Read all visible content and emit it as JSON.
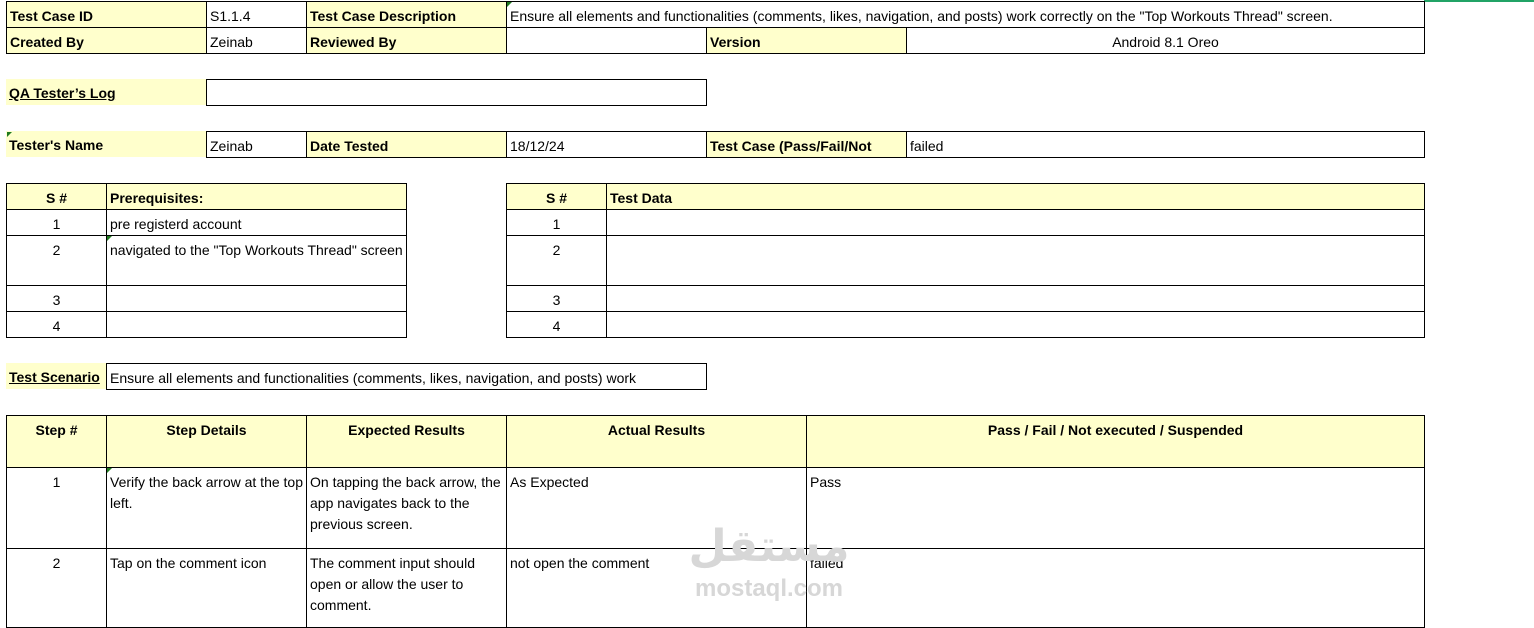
{
  "header": {
    "test_case_id_label": "Test Case ID",
    "test_case_id": "S1.1.4",
    "description_label": "Test Case Description",
    "description": "Ensure all elements and functionalities (comments, likes, navigation, and posts) work correctly on the \"Top Workouts Thread\" screen.",
    "created_by_label": "Created By",
    "created_by": "Zeinab",
    "reviewed_by_label": "Reviewed By",
    "reviewed_by": "",
    "version_label": "Version",
    "version": "Android 8.1 Oreo"
  },
  "qa_log": {
    "label": "QA Tester’s Log",
    "value": ""
  },
  "tester": {
    "name_label": "Tester's Name",
    "name": "Zeinab",
    "date_label": "Date Tested",
    "date": "18/12/24",
    "result_label": "Test Case (Pass/Fail/Not",
    "result": "failed"
  },
  "prerequisites": {
    "num_header": "S #",
    "header": "Prerequisites:",
    "rows": [
      {
        "num": "1",
        "text": "pre registerd account"
      },
      {
        "num": "2",
        "text": " navigated to the \"Top Workouts Thread\" screen"
      },
      {
        "num": "3",
        "text": ""
      },
      {
        "num": "4",
        "text": ""
      }
    ]
  },
  "test_data": {
    "num_header": "S #",
    "header": "Test Data",
    "rows": [
      {
        "num": "1",
        "text": ""
      },
      {
        "num": "2",
        "text": ""
      },
      {
        "num": "3",
        "text": ""
      },
      {
        "num": "4",
        "text": ""
      }
    ]
  },
  "scenario": {
    "label": "Test Scenario",
    "text": "Ensure all elements and functionalities (comments, likes, navigation, and posts) work"
  },
  "steps": {
    "headers": [
      "Step #",
      "Step Details",
      "Expected Results",
      "Actual Results",
      "Pass / Fail / Not executed / Suspended"
    ],
    "rows": [
      {
        "num": "1",
        "details": "Verify the back arrow at the top left.",
        "expected": "On tapping the back arrow, the app navigates back to the previous screen.",
        "actual": "As Expected",
        "status": "Pass"
      },
      {
        "num": "2",
        "details": "Tap on the comment icon",
        "expected": "The comment input should open or allow the user to comment.",
        "actual": "not open the comment",
        "status": "failed"
      }
    ]
  },
  "watermark": {
    "arabic": "مستقل",
    "latin": "mostaql.com"
  }
}
